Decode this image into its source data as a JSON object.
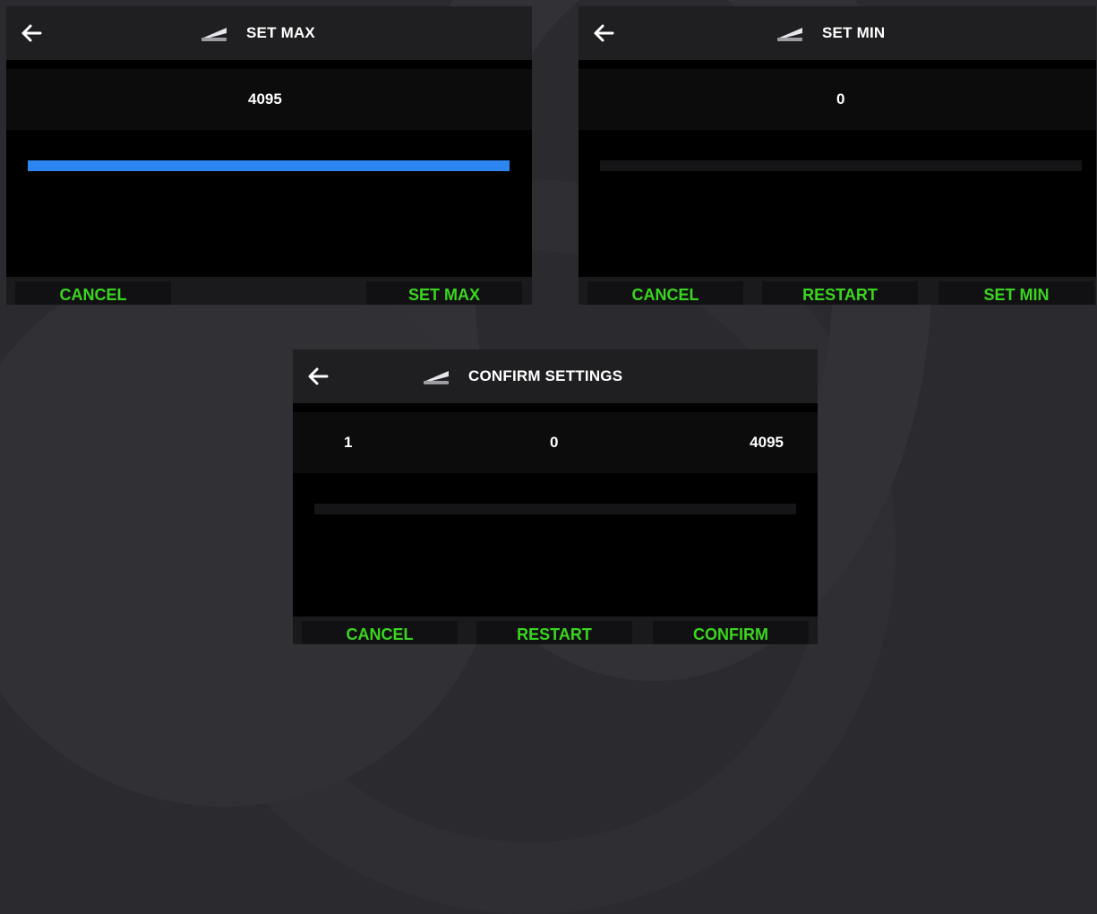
{
  "icons": {
    "back": "back-arrow-icon",
    "pedal": "pedal-icon"
  },
  "colors": {
    "accent_blue": "#2d86f0",
    "button_green": "#3ad61f",
    "background": "#2b2a2f"
  },
  "screen_max": {
    "title": "SET MAX",
    "value": "4095",
    "progress": 1.0,
    "buttons": {
      "cancel": "CANCEL",
      "set_max": "SET MAX"
    }
  },
  "screen_min": {
    "title": "SET MIN",
    "value": "0",
    "progress": 0.0,
    "buttons": {
      "cancel": "CANCEL",
      "restart": "RESTART",
      "set_min": "SET MIN"
    }
  },
  "screen_confirm": {
    "title": "CONFIRM SETTINGS",
    "values": {
      "left": "1",
      "middle": "0",
      "right": "4095"
    },
    "progress": 0.0,
    "buttons": {
      "cancel": "CANCEL",
      "restart": "RESTART",
      "confirm": "CONFIRM"
    }
  }
}
